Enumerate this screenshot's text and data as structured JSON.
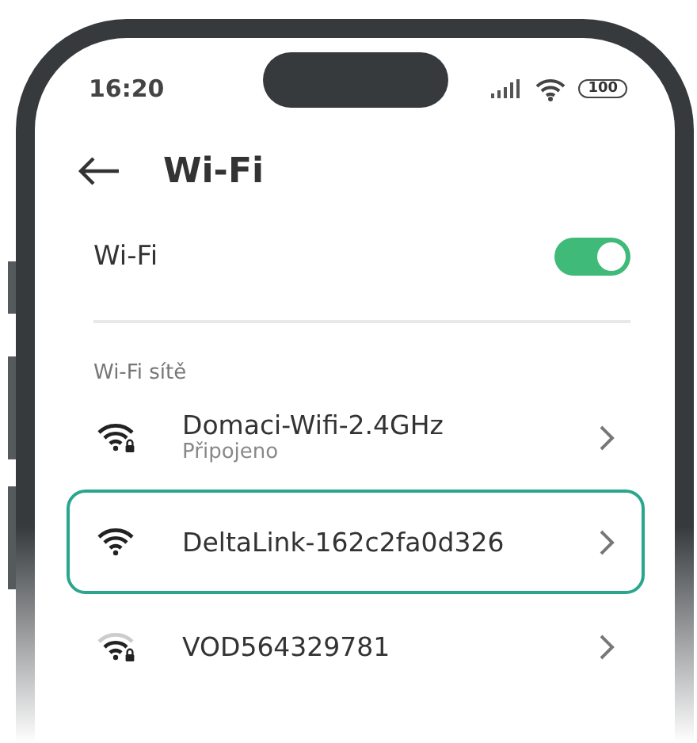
{
  "status_bar": {
    "time": "16:20",
    "battery": "100"
  },
  "header": {
    "title": "Wi-Fi"
  },
  "wifi_toggle": {
    "label": "Wi-Fi",
    "on": true
  },
  "section_label": "Wi-Fi sítě",
  "networks": [
    {
      "name": "Domaci-Wifi-2.4GHz",
      "status": "Připojeno",
      "locked": true,
      "weak": false,
      "selected": false
    },
    {
      "name": "DeltaLink-162c2fa0d326",
      "locked": false,
      "weak": false,
      "selected": true
    },
    {
      "name": "VOD564329781",
      "locked": true,
      "weak": true,
      "selected": false
    }
  ]
}
